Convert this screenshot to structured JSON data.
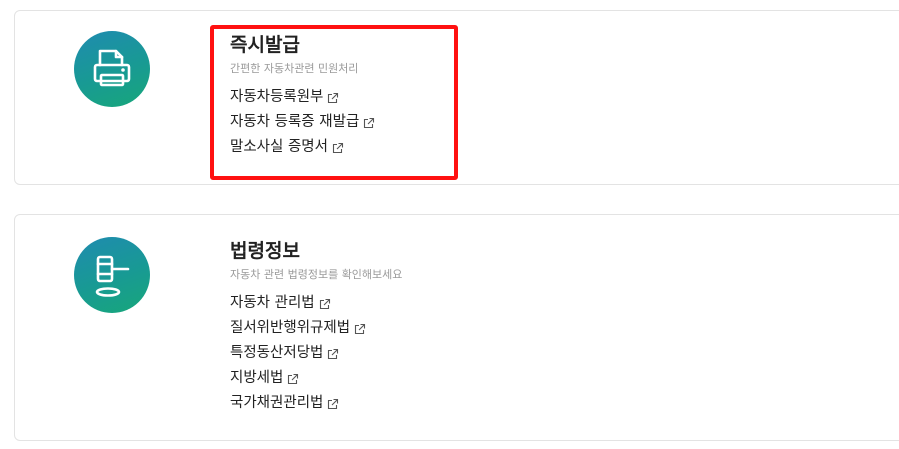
{
  "sections": [
    {
      "icon": "printer-icon",
      "title": "즉시발급",
      "subtitle": "간편한 자동차관련 민원처리",
      "links": [
        {
          "label": "자동차등록원부",
          "icon": "external-link-icon"
        },
        {
          "label": "자동차 등록증 재발급",
          "icon": "external-link-icon"
        },
        {
          "label": "말소사실 증명서",
          "icon": "external-link-icon"
        }
      ]
    },
    {
      "icon": "gavel-icon",
      "title": "법령정보",
      "subtitle": "자동차 관련 법령정보를 확인해보세요",
      "links": [
        {
          "label": "자동차 관리법",
          "icon": "external-link-icon"
        },
        {
          "label": "질서위반행위규제법",
          "icon": "external-link-icon"
        },
        {
          "label": "특정동산저당법",
          "icon": "external-link-icon"
        },
        {
          "label": "지방세법",
          "icon": "external-link-icon"
        },
        {
          "label": "국가채권관리법",
          "icon": "external-link-icon"
        }
      ]
    }
  ],
  "colors": {
    "highlight": "#ff1111",
    "icon_gradient_start": "#1f8bb0",
    "icon_gradient_end": "#17a77a"
  }
}
